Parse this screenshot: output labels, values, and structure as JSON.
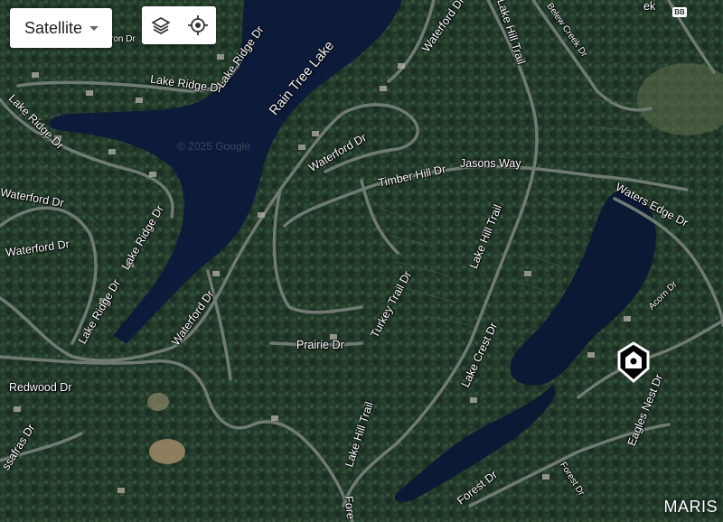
{
  "map": {
    "copyright": "© 2025 Google",
    "highway_shield": "BB",
    "brand": "MARIS"
  },
  "controls": {
    "map_type": "Satellite",
    "layers_icon": "layers-icon",
    "locate_icon": "crosshair-icon"
  },
  "labels": {
    "rain_tree_lake": "Rain Tree Lake",
    "lake_ridge_1": "Lake Ridge Dr",
    "lake_ridge_2": "Lake Ridge Dr",
    "lake_ridge_3": "Lake Ridge Dr",
    "lake_ridge_4": "Lake Ridge Dr",
    "lake_ridge_5": "Lake Ridge Dr",
    "waterford_1": "Waterford Dr",
    "waterford_2": "Waterford Dr",
    "waterford_3": "Waterford Dr",
    "waterford_4": "Waterford Dr",
    "waterford_5": "Waterford Dr",
    "lake_hill_1": "Lake Hill Trail",
    "lake_hill_2": "Lake Hill Trail",
    "lake_hill_3": "Lake Hill Trail",
    "belew_creek": "Belew Creek Dr",
    "ek": "ek",
    "ron": "ron Dr",
    "timber_hill": "Timber Hill Dr",
    "jasons_way": "Jasons Way",
    "waters_edge": "Waters Edge Dr",
    "acorn": "Acorn Dr",
    "turkey_trail": "Turkey Trail Dr",
    "prairie": "Prairie Dr",
    "lake_crest": "Lake Crest Dr",
    "eagles_nest": "Eagles Nest Dr",
    "redwood": "Redwood Dr",
    "sassafras": "ssafras Dr",
    "forest_1": "Forest Dr",
    "forest_2": "Forest Dr",
    "fore": "Fore"
  }
}
